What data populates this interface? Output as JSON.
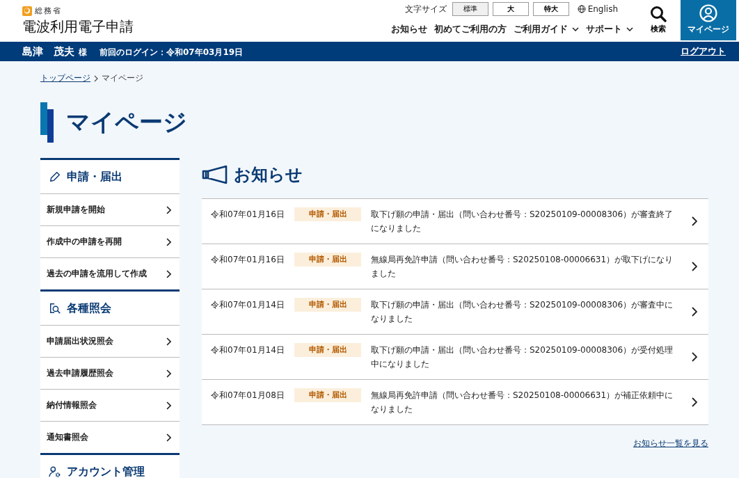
{
  "header": {
    "ministry": "総務省",
    "site_title": "電波利用電子申請",
    "font_size_label": "文字サイズ",
    "font_sizes": [
      {
        "label": "標準",
        "selected": true
      },
      {
        "label": "大",
        "selected": false
      },
      {
        "label": "特大",
        "selected": false
      }
    ],
    "language_link": "English",
    "nav": [
      {
        "label": "お知らせ",
        "dropdown": false
      },
      {
        "label": "初めてご利用の方",
        "dropdown": false
      },
      {
        "label": "ご利用ガイド",
        "dropdown": true
      },
      {
        "label": "サポート",
        "dropdown": true
      }
    ],
    "search_label": "検索",
    "mypage_label": "マイページ"
  },
  "user_bar": {
    "family_name": "島津",
    "given_name": "茂夫",
    "honorific": "様",
    "last_login": "前回のログイン：令和07年03月19日",
    "logout": "ログアウト"
  },
  "breadcrumb": [
    {
      "label": "トップページ",
      "link": true
    },
    {
      "label": "マイページ",
      "link": false
    }
  ],
  "page_title": "マイページ",
  "sidebar": [
    {
      "kind": "pencil",
      "title": "申請・届出",
      "items": [
        "新規申請を開始",
        "作成中の申請を再開",
        "過去の申請を流用して作成"
      ]
    },
    {
      "kind": "search",
      "title": "各種照会",
      "items": [
        "申請届出状況照会",
        "過去申請履歴照会",
        "納付情報照会",
        "通知書照会"
      ]
    },
    {
      "kind": "account",
      "title": "アカウント管理"
    }
  ],
  "notices": {
    "title": "お知らせ",
    "items": [
      {
        "date": "令和07年01月16日",
        "category": "申請・届出",
        "message": "取下げ願の申請・届出（問い合わせ番号：S20250109-00008306）が審査終了になりました"
      },
      {
        "date": "令和07年01月16日",
        "category": "申請・届出",
        "message": "無線局再免許申請（問い合わせ番号：S20250108-00006631）が取下げになりました"
      },
      {
        "date": "令和07年01月14日",
        "category": "申請・届出",
        "message": "取下げ願の申請・届出（問い合わせ番号：S20250109-00008306）が審査中になりました"
      },
      {
        "date": "令和07年01月14日",
        "category": "申請・届出",
        "message": "取下げ願の申請・届出（問い合わせ番号：S20250109-00008306）が受付処理中になりました"
      },
      {
        "date": "令和07年01月08日",
        "category": "申請・届出",
        "message": "無線局再免許申請（問い合わせ番号：S20250108-00006631）が補正依頼中になりました"
      }
    ],
    "more_link": "お知らせ一覧を見る"
  }
}
